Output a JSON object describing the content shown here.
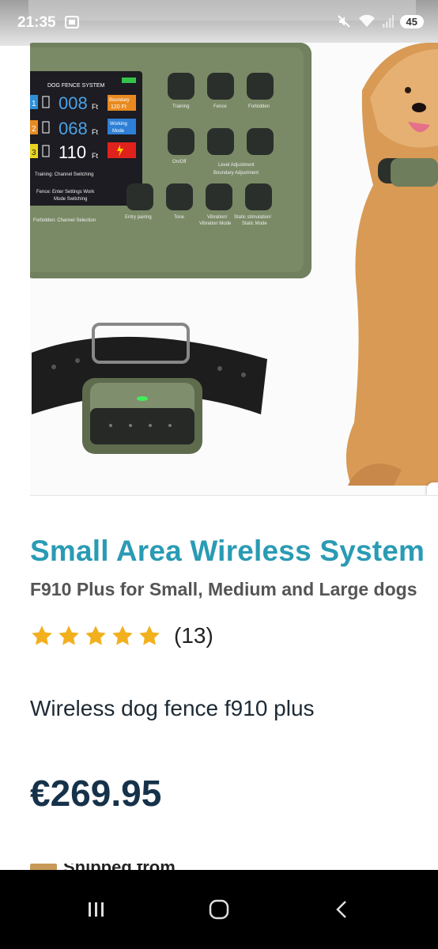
{
  "status_bar": {
    "time": "21:35",
    "battery": "45",
    "icons": [
      "screenshot-icon",
      "mute-icon",
      "wifi-icon",
      "signal-icon",
      "battery-icon"
    ]
  },
  "product_image": {
    "controller_label": "DOG FENCE SYSTEM",
    "channels": [
      {
        "num": "1",
        "value": "008",
        "unit": "Ft",
        "badge": "Boundary 120 Ft"
      },
      {
        "num": "2",
        "value": "068",
        "unit": "Ft",
        "badge": "Working Mode"
      },
      {
        "num": "3",
        "value": "110",
        "unit": "Ft",
        "badge": ""
      }
    ],
    "button_labels": {
      "training": "Training",
      "fence": "Fence",
      "forbidden": "Forbidden",
      "onoff": "On/Off",
      "level": "Level Adjustment",
      "boundary": "Boundary Adjustment",
      "entry": "Entry pairing",
      "tone": "Tone",
      "vibration": "Vibration/ Vibration Mode",
      "static": "Static stimulation/ Static Mode"
    },
    "callouts": [
      "Training: Channel Switching",
      "Fence: Enter Settings Work Mode Switching",
      "Forbidden: Channel Selection"
    ]
  },
  "product": {
    "title": "Small Area Wireless System",
    "subtitle": "F910 Plus for Small, Medium and Large dogs",
    "rating_stars": 5,
    "rating_count": "(13)",
    "short_description": "Wireless dog fence f910 plus",
    "price": "€269.95",
    "shipping_text": "Shipped from..."
  },
  "colors": {
    "title": "#2a9bb4",
    "price": "#16324a",
    "star": "#f2b01e",
    "device_green": "#6d7c5b"
  }
}
